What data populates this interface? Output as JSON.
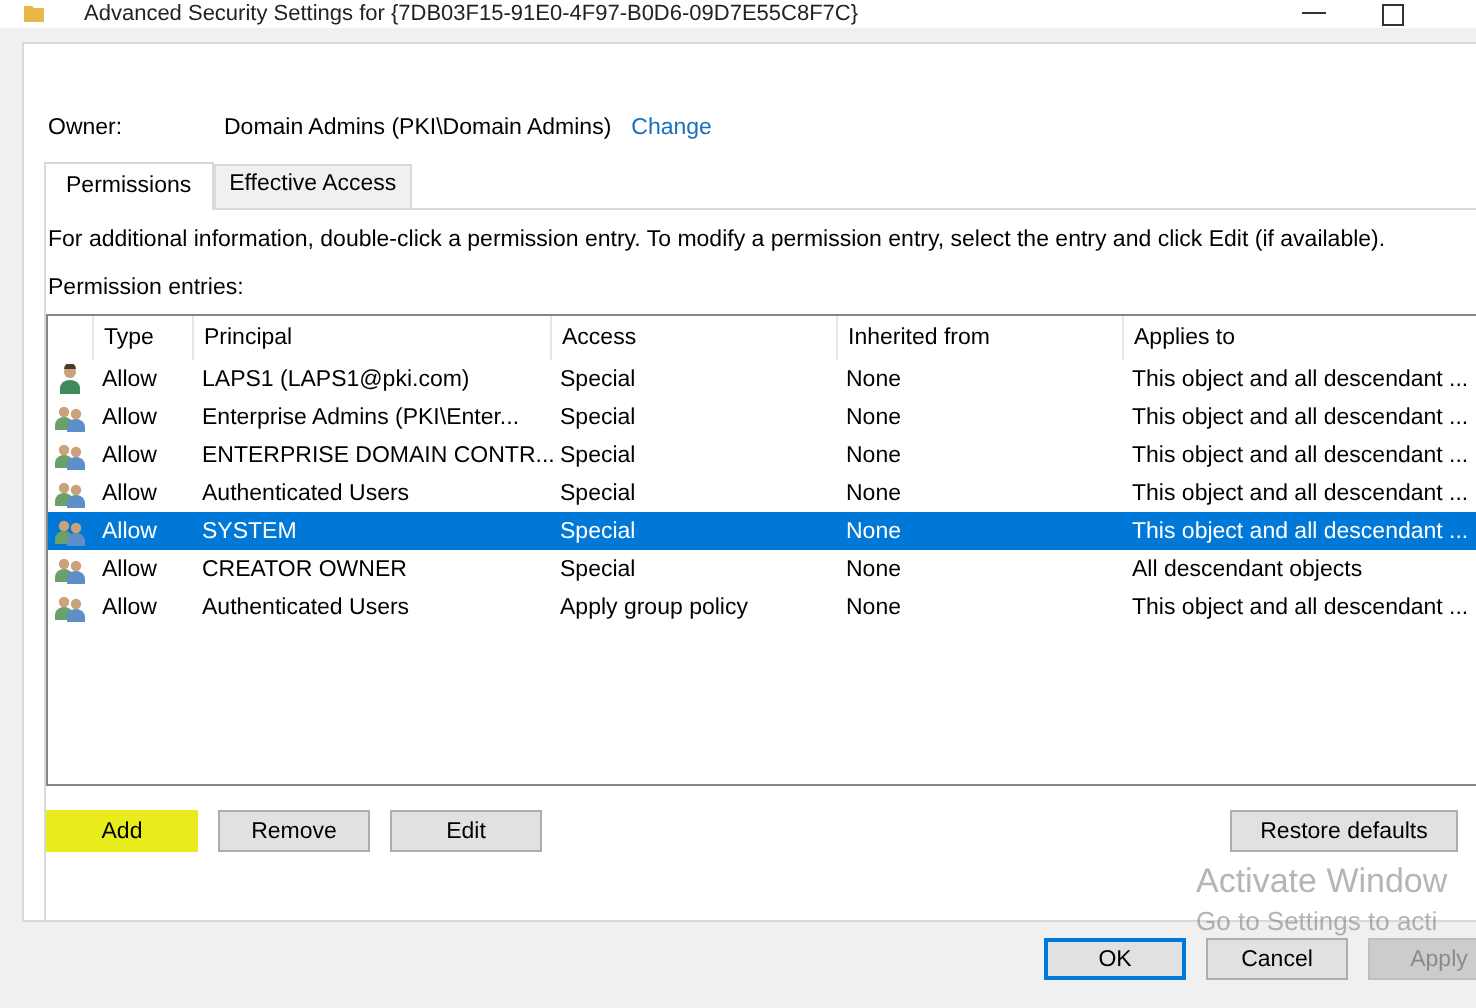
{
  "window": {
    "title": "Advanced Security Settings for {7DB03F15-91E0-4F97-B0D6-09D7E55C8F7C}"
  },
  "owner": {
    "label": "Owner:",
    "value": "Domain Admins (PKI\\Domain Admins)",
    "link": "Change"
  },
  "tabs": [
    {
      "label": "Permissions",
      "selected": true
    },
    {
      "label": "Effective Access",
      "selected": false
    }
  ],
  "info": "For additional information, double-click a permission entry. To modify a permission entry, select the entry and click Edit (if available).",
  "entries_label": "Permission entries:",
  "table": {
    "columns": [
      "Type",
      "Principal",
      "Access",
      "Inherited from",
      "Applies to"
    ],
    "rows": [
      {
        "kind": "user",
        "selected": false,
        "cells": [
          "Allow",
          "LAPS1 (LAPS1@pki.com)",
          "Special",
          "None",
          "This object and all descendant ..."
        ]
      },
      {
        "kind": "group",
        "selected": false,
        "cells": [
          "Allow",
          "Enterprise Admins (PKI\\Enter...",
          "Special",
          "None",
          "This object and all descendant ..."
        ]
      },
      {
        "kind": "group",
        "selected": false,
        "cells": [
          "Allow",
          "ENTERPRISE DOMAIN CONTR...",
          "Special",
          "None",
          "This object and all descendant ..."
        ]
      },
      {
        "kind": "group",
        "selected": false,
        "cells": [
          "Allow",
          "Authenticated Users",
          "Special",
          "None",
          "This object and all descendant ..."
        ]
      },
      {
        "kind": "group",
        "selected": true,
        "cells": [
          "Allow",
          "SYSTEM",
          "Special",
          "None",
          "This object and all descendant ..."
        ]
      },
      {
        "kind": "group",
        "selected": false,
        "cells": [
          "Allow",
          "CREATOR OWNER",
          "Special",
          "None",
          "All descendant objects"
        ]
      },
      {
        "kind": "group",
        "selected": false,
        "cells": [
          "Allow",
          "Authenticated Users",
          "Apply group policy",
          "None",
          "This object and all descendant ..."
        ]
      }
    ]
  },
  "entry_buttons": [
    {
      "label": "Add",
      "highlighted": true
    },
    {
      "label": "Remove",
      "highlighted": false
    },
    {
      "label": "Edit",
      "highlighted": false
    }
  ],
  "restore_button": "Restore defaults",
  "activation_notice": {
    "title": "Activate Window",
    "subtitle": "Go to Settings to acti"
  },
  "dialog_buttons": [
    {
      "label": "OK",
      "default": true,
      "disabled": false
    },
    {
      "label": "Cancel",
      "default": false,
      "disabled": false
    },
    {
      "label": "Apply",
      "default": false,
      "disabled": true
    }
  ]
}
